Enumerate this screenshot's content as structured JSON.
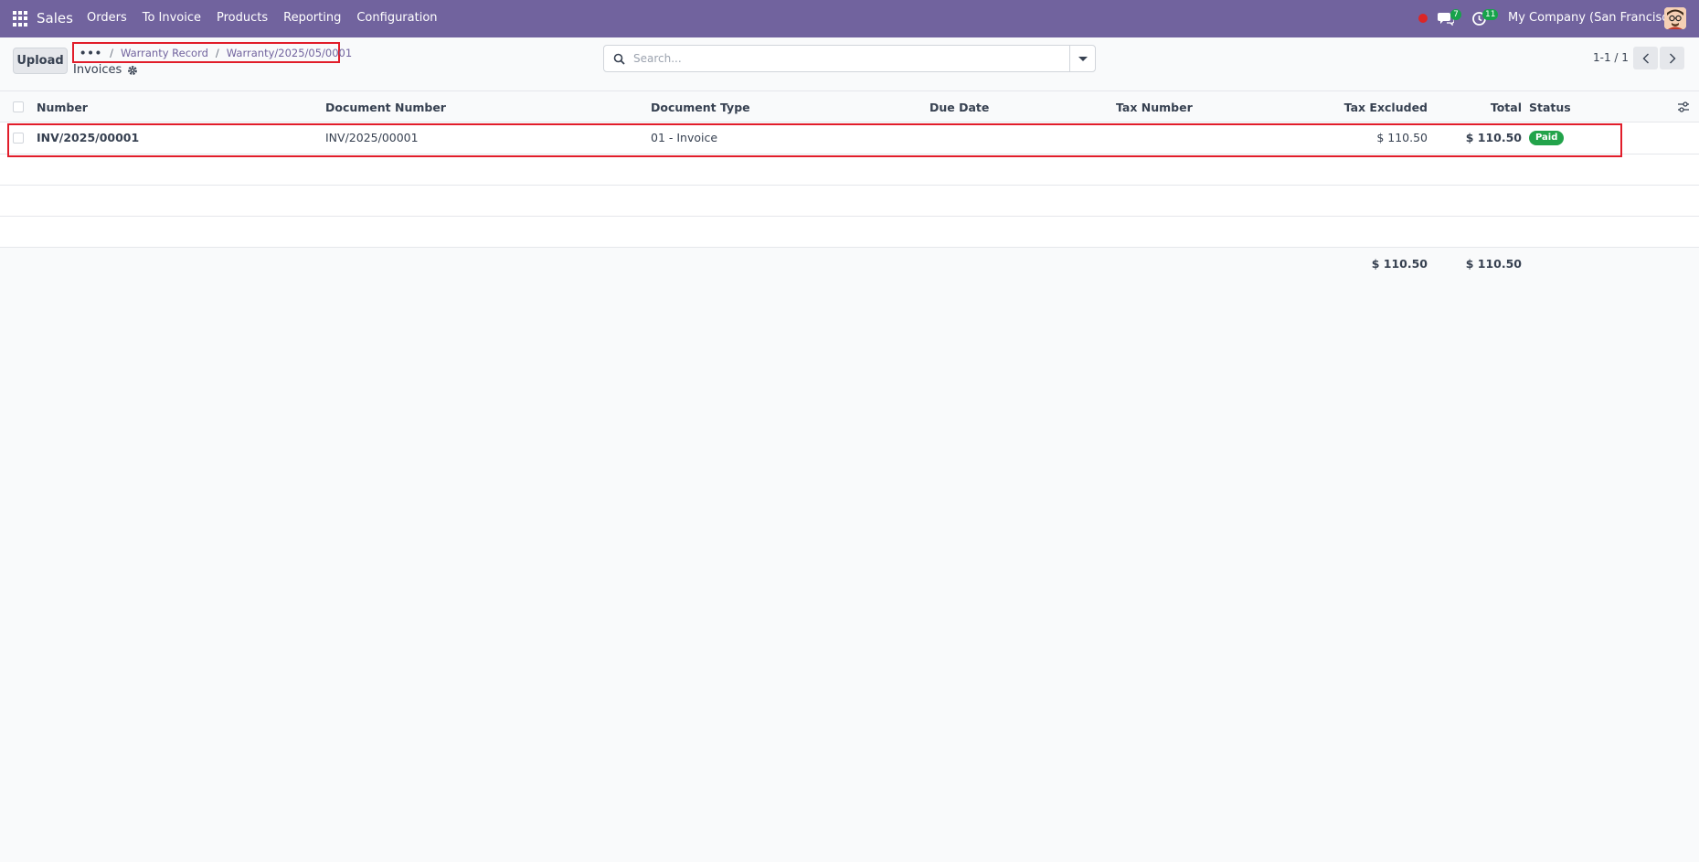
{
  "navbar": {
    "app_name": "Sales",
    "menu": [
      "Orders",
      "To Invoice",
      "Products",
      "Reporting",
      "Configuration"
    ],
    "messages_count": "7",
    "activities_count": "11",
    "company": "My Company (San Francisco)",
    "accent_color": "#71639e"
  },
  "control": {
    "upload_label": "Upload",
    "breadcrumb": {
      "ellipsis": "•••",
      "items": [
        "Warranty Record",
        "Warranty/2025/05/0001"
      ]
    },
    "title": "Invoices",
    "search_placeholder": "Search...",
    "pager": "1-1 / 1"
  },
  "table": {
    "columns": [
      "Number",
      "Document Number",
      "Document Type",
      "Due Date",
      "Tax Number",
      "Tax Excluded",
      "Total",
      "Status"
    ],
    "rows": [
      {
        "number": "INV/2025/00001",
        "document_number": "INV/2025/00001",
        "document_type": "01 - Invoice",
        "due_date": "",
        "tax_number": "",
        "tax_excluded": "$ 110.50",
        "total": "$ 110.50",
        "status": "Paid"
      }
    ],
    "totals": {
      "tax_excluded": "$ 110.50",
      "total": "$ 110.50"
    }
  },
  "icons": {
    "apps": "apps-grid-icon",
    "messages": "chat-icon",
    "activities": "clock-icon",
    "settings": "gear-icon",
    "search": "search-icon",
    "optional_columns": "sliders-icon"
  }
}
